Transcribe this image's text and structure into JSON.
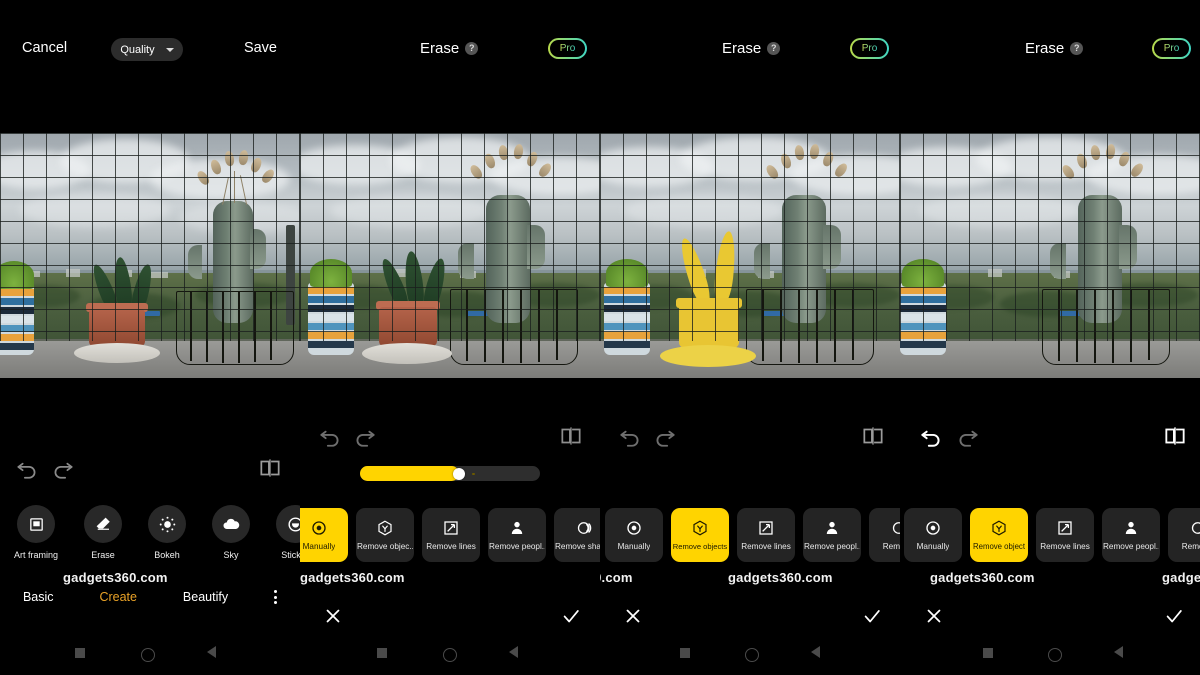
{
  "app": {
    "watermark": "gadgets360.com",
    "accent_yellow": "#FFD400",
    "active_category_color": "#E9A227"
  },
  "panel1": {
    "topbar": {
      "cancel_label": "Cancel",
      "save_label": "Save",
      "quality_label": "Quality",
      "quality_caret_icon": "chevron-down-icon"
    },
    "controls": {
      "undo_icon": "undo-icon",
      "redo_icon": "redo-icon",
      "compare_icon": "compare-split-icon"
    },
    "tools": [
      {
        "label": "Art framing",
        "icon": "art-framing-icon"
      },
      {
        "label": "Erase",
        "icon": "eraser-icon"
      },
      {
        "label": "Bokeh",
        "icon": "bokeh-icon"
      },
      {
        "label": "Sky",
        "icon": "cloud-icon"
      },
      {
        "label": "Sticker",
        "icon": "sticker-icon"
      }
    ],
    "categories": [
      {
        "label": "Basic",
        "active": false
      },
      {
        "label": "Create",
        "active": true
      },
      {
        "label": "Beautify",
        "active": false
      }
    ],
    "overflow_icon": "kebab-menu-icon"
  },
  "panel2": {
    "topbar": {
      "title": "Erase",
      "help_icon": "help-question-icon",
      "pro_label": "Pro"
    },
    "controls": {
      "undo_icon": "undo-icon",
      "redo_icon": "redo-icon",
      "compare_icon": "compare-split-icon"
    },
    "slider": {
      "value_percent": 55
    },
    "tiles": [
      {
        "label": "Manually",
        "icon": "manual-brush-icon",
        "selected": true,
        "download_badge": false
      },
      {
        "label": "Remove objec..",
        "icon": "remove-object-icon",
        "selected": false,
        "download_badge": false
      },
      {
        "label": "Remove lines",
        "icon": "remove-lines-icon",
        "selected": false,
        "download_badge": false
      },
      {
        "label": "Remove peopl..",
        "icon": "remove-people-icon",
        "selected": false,
        "download_badge": false
      },
      {
        "label": "Remove shadow",
        "icon": "remove-shadow-icon",
        "selected": false,
        "download_badge": true
      }
    ],
    "footer": {
      "cancel_icon": "close-x-icon",
      "confirm_icon": "check-icon"
    }
  },
  "panel3": {
    "topbar": {
      "title": "Erase",
      "help_icon": "help-question-icon",
      "pro_label": "Pro"
    },
    "controls": {
      "undo_icon": "undo-icon",
      "redo_icon": "redo-icon",
      "compare_icon": "compare-split-icon"
    },
    "tiles": [
      {
        "label": "Manually",
        "icon": "manual-brush-icon",
        "selected": false,
        "download_badge": false
      },
      {
        "label": "Remove objects",
        "icon": "remove-object-icon",
        "selected": true,
        "download_badge": false
      },
      {
        "label": "Remove lines",
        "icon": "remove-lines-icon",
        "selected": false,
        "download_badge": false
      },
      {
        "label": "Remove peopl..",
        "icon": "remove-people-icon",
        "selected": false,
        "download_badge": false
      },
      {
        "label": "Remove",
        "icon": "remove-shadow-icon",
        "selected": false,
        "download_badge": false
      }
    ],
    "footer": {
      "cancel_icon": "close-x-icon",
      "confirm_icon": "check-icon"
    }
  },
  "panel4": {
    "topbar": {
      "title": "Erase",
      "help_icon": "help-question-icon",
      "pro_label": "Pro"
    },
    "controls": {
      "undo_icon": "undo-icon",
      "redo_icon": "redo-icon",
      "compare_icon": "compare-split-icon"
    },
    "tiles": [
      {
        "label": "Manually",
        "icon": "manual-brush-icon",
        "selected": false,
        "download_badge": false
      },
      {
        "label": "Remove object",
        "icon": "remove-object-icon",
        "selected": true,
        "download_badge": false
      },
      {
        "label": "Remove lines",
        "icon": "remove-lines-icon",
        "selected": false,
        "download_badge": false
      },
      {
        "label": "Remove peopl..",
        "icon": "remove-people-icon",
        "selected": false,
        "download_badge": false
      },
      {
        "label": "Remove",
        "icon": "remove-shadow-icon",
        "selected": false,
        "download_badge": false
      }
    ],
    "footer": {
      "cancel_icon": "close-x-icon",
      "confirm_icon": "check-icon"
    }
  },
  "navbar": {
    "recents_icon": "square-recents-icon",
    "home_icon": "circle-home-icon",
    "back_icon": "triangle-back-icon"
  }
}
